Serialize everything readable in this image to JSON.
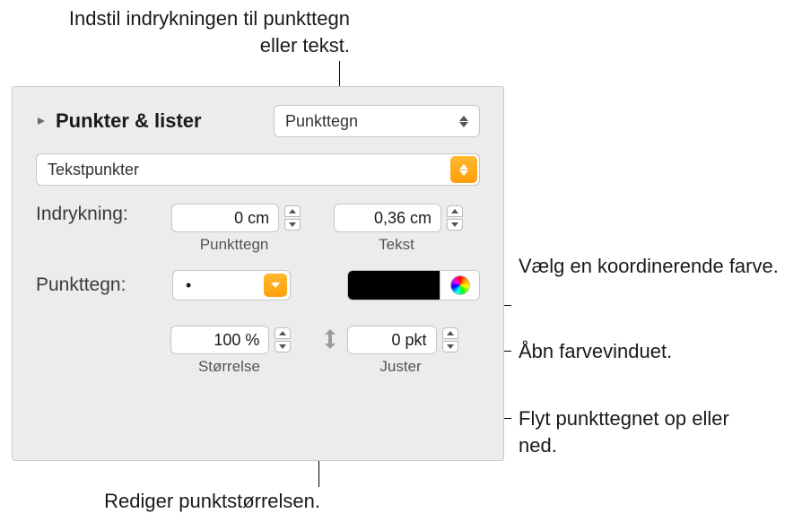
{
  "callouts": {
    "top": "Indstil indrykningen til punkttegn eller tekst.",
    "color": "Vælg en koordinerende farve.",
    "wheel": "Åbn farvevinduet.",
    "align": "Flyt punkttegnet op eller ned.",
    "size": "Rediger punktstørrelsen."
  },
  "section": {
    "title": "Punkter & lister",
    "style_popup": "Punkttegn"
  },
  "bullet_type_popup": "Tekstpunkter",
  "indent": {
    "label": "Indrykning:",
    "bullet_value": "0 cm",
    "bullet_sublabel": "Punkttegn",
    "text_value": "0,36 cm",
    "text_sublabel": "Tekst"
  },
  "bullet": {
    "label": "Punkttegn:",
    "glyph": "•"
  },
  "size": {
    "value": "100 %",
    "sublabel": "Størrelse"
  },
  "align": {
    "value": "0 pkt",
    "sublabel": "Juster"
  }
}
